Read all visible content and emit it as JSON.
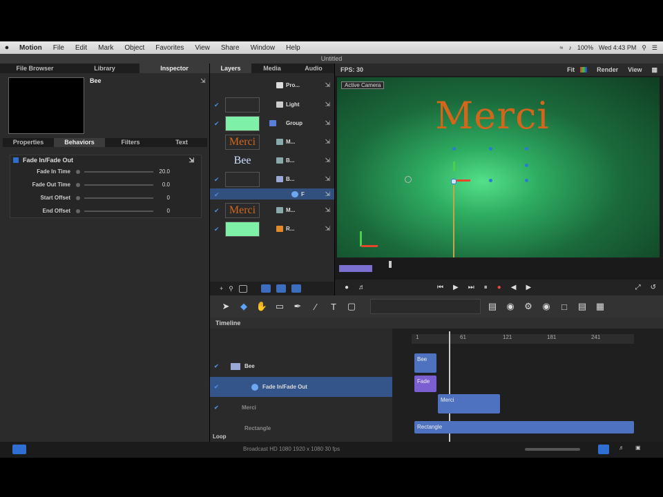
{
  "menubar": {
    "apple": "",
    "items": [
      "Motion",
      "File",
      "Edit",
      "Mark",
      "Object",
      "Favorites",
      "View",
      "Share",
      "Window",
      "Help"
    ],
    "battery": "100%",
    "clock": "Wed 4:43 PM"
  },
  "window_title": "Untitled",
  "left_tabs": [
    "File Browser",
    "Library",
    "Inspector"
  ],
  "object_name": "Bee",
  "sub_tabs": [
    "Properties",
    "Behaviors",
    "Filters",
    "Text"
  ],
  "behavior": {
    "name": "Fade In/Fade Out",
    "params": [
      {
        "label": "Fade In Time",
        "value": "20.0"
      },
      {
        "label": "Fade Out Time",
        "value": "0.0"
      },
      {
        "label": "Start Offset",
        "value": "0"
      },
      {
        "label": "End Offset",
        "value": "0"
      }
    ]
  },
  "layers_tabs": [
    "Layers",
    "Media",
    "Audio"
  ],
  "layers": [
    {
      "name": "Pro...",
      "thumb": ""
    },
    {
      "name": "Light",
      "thumb": ""
    },
    {
      "name": "Group",
      "thumb": ""
    },
    {
      "name": "M...",
      "thumb": "Merci"
    },
    {
      "name": "B...",
      "thumb": "Bee"
    },
    {
      "name": "B...",
      "thumb": ""
    },
    {
      "name": "F",
      "thumb": ""
    },
    {
      "name": "M...",
      "thumb": "Merci"
    },
    {
      "name": "R...",
      "thumb": ""
    }
  ],
  "canvas": {
    "fps": "FPS: 30",
    "fit": "Fit",
    "render": "Render",
    "view": "View",
    "camera": "Active Camera",
    "text": "Merci"
  },
  "timeline": {
    "title": "Timeline",
    "rows": [
      "",
      "Bee",
      "Fade In/Fade Out",
      "Merci",
      "Rectangle"
    ],
    "ruler": [
      "1",
      "61",
      "121",
      "181",
      "241"
    ],
    "bars": [
      "Bee",
      "Fade",
      "Merci",
      "Rectangle"
    ],
    "footer": "Loop"
  },
  "status": "Broadcast HD 1080 1920 x 1080 30 fps",
  "colors": {
    "accent": "#2f6fd1",
    "merci": "#d2661a",
    "canvas": "#2fae62"
  }
}
